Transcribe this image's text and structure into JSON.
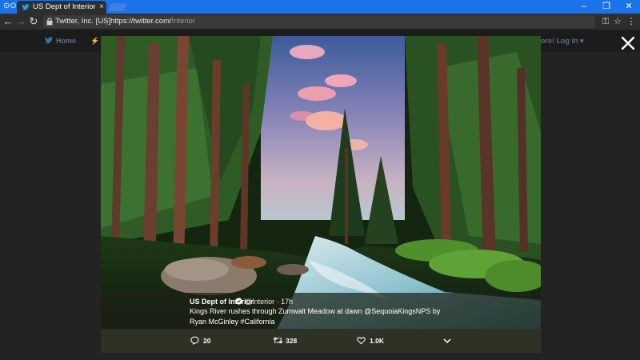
{
  "browser": {
    "tab_title": "US Dept of Interior (@Int",
    "tab_close": "×",
    "site_name": "Twitter, Inc. [US]",
    "url_scheme": "https://twitter.com/",
    "url_path": "Interior"
  },
  "twitter_nav": {
    "home_label": "Home",
    "login_label": "ore!  Log in ▾"
  },
  "tweet": {
    "author_name": "US Dept of Interior",
    "meta": "@Interior · 17h",
    "text": "Kings River rushes through Zumwalt Meadow at dawn @SequoiaKingsNPS by Ryan McGinley #California",
    "replies": "20",
    "retweets": "328",
    "likes": "1.0K"
  },
  "colors": {
    "tab_strip": "#1a73e8",
    "toolbar": "#2e2e2e",
    "overlay": "#232323",
    "card": "#2d3225"
  },
  "icons": [
    "incognito-icon",
    "twitter-bird-icon",
    "lock-icon",
    "key-icon",
    "star-icon",
    "menu-icon",
    "close-icon",
    "verified-icon",
    "reply-icon",
    "retweet-icon",
    "like-icon",
    "chevron-down-icon"
  ]
}
